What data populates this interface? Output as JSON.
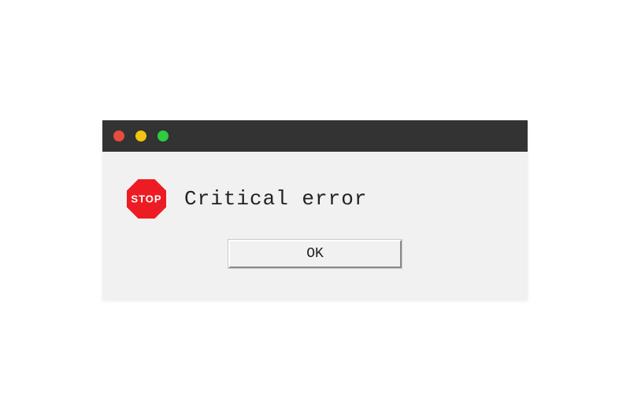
{
  "dialog": {
    "icon": {
      "name": "stop-sign-icon",
      "label": "STOP",
      "color": "#ed1c24"
    },
    "message": "Critical error",
    "button_label": "OK",
    "traffic_lights": [
      {
        "name": "close",
        "color": "#e74c3c"
      },
      {
        "name": "minimize",
        "color": "#f1c40f"
      },
      {
        "name": "zoom",
        "color": "#2ecc40"
      }
    ]
  }
}
